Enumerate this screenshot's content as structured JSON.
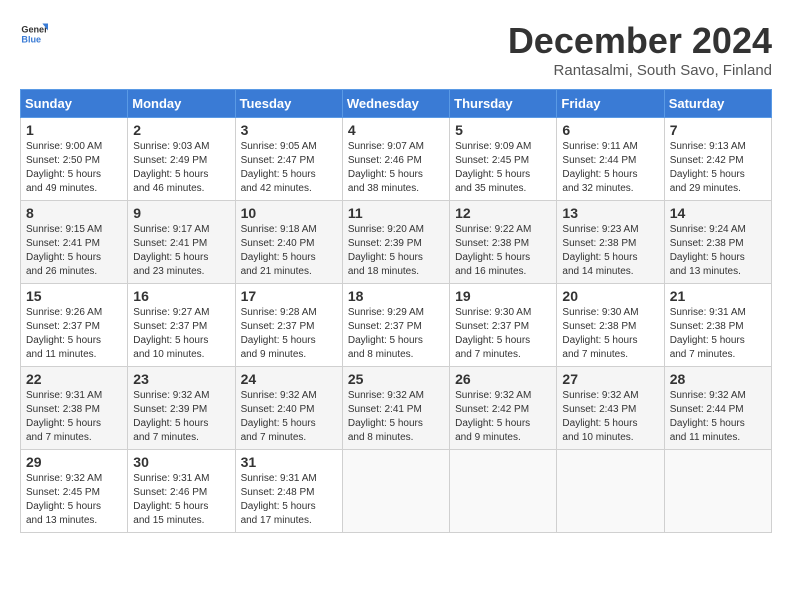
{
  "logo": {
    "general": "General",
    "blue": "Blue"
  },
  "title": "December 2024",
  "location": "Rantasalmi, South Savo, Finland",
  "days_of_week": [
    "Sunday",
    "Monday",
    "Tuesday",
    "Wednesday",
    "Thursday",
    "Friday",
    "Saturday"
  ],
  "weeks": [
    [
      {
        "day": "1",
        "sunrise": "9:00 AM",
        "sunset": "2:50 PM",
        "daylight_hours": "5",
        "daylight_minutes": "49"
      },
      {
        "day": "2",
        "sunrise": "9:03 AM",
        "sunset": "2:49 PM",
        "daylight_hours": "5",
        "daylight_minutes": "46"
      },
      {
        "day": "3",
        "sunrise": "9:05 AM",
        "sunset": "2:47 PM",
        "daylight_hours": "5",
        "daylight_minutes": "42"
      },
      {
        "day": "4",
        "sunrise": "9:07 AM",
        "sunset": "2:46 PM",
        "daylight_hours": "5",
        "daylight_minutes": "38"
      },
      {
        "day": "5",
        "sunrise": "9:09 AM",
        "sunset": "2:45 PM",
        "daylight_hours": "5",
        "daylight_minutes": "35"
      },
      {
        "day": "6",
        "sunrise": "9:11 AM",
        "sunset": "2:44 PM",
        "daylight_hours": "5",
        "daylight_minutes": "32"
      },
      {
        "day": "7",
        "sunrise": "9:13 AM",
        "sunset": "2:42 PM",
        "daylight_hours": "5",
        "daylight_minutes": "29"
      }
    ],
    [
      {
        "day": "8",
        "sunrise": "9:15 AM",
        "sunset": "2:41 PM",
        "daylight_hours": "5",
        "daylight_minutes": "26"
      },
      {
        "day": "9",
        "sunrise": "9:17 AM",
        "sunset": "2:41 PM",
        "daylight_hours": "5",
        "daylight_minutes": "23"
      },
      {
        "day": "10",
        "sunrise": "9:18 AM",
        "sunset": "2:40 PM",
        "daylight_hours": "5",
        "daylight_minutes": "21"
      },
      {
        "day": "11",
        "sunrise": "9:20 AM",
        "sunset": "2:39 PM",
        "daylight_hours": "5",
        "daylight_minutes": "18"
      },
      {
        "day": "12",
        "sunrise": "9:22 AM",
        "sunset": "2:38 PM",
        "daylight_hours": "5",
        "daylight_minutes": "16"
      },
      {
        "day": "13",
        "sunrise": "9:23 AM",
        "sunset": "2:38 PM",
        "daylight_hours": "5",
        "daylight_minutes": "14"
      },
      {
        "day": "14",
        "sunrise": "9:24 AM",
        "sunset": "2:38 PM",
        "daylight_hours": "5",
        "daylight_minutes": "13"
      }
    ],
    [
      {
        "day": "15",
        "sunrise": "9:26 AM",
        "sunset": "2:37 PM",
        "daylight_hours": "5",
        "daylight_minutes": "11"
      },
      {
        "day": "16",
        "sunrise": "9:27 AM",
        "sunset": "2:37 PM",
        "daylight_hours": "5",
        "daylight_minutes": "10"
      },
      {
        "day": "17",
        "sunrise": "9:28 AM",
        "sunset": "2:37 PM",
        "daylight_hours": "5",
        "daylight_minutes": "9"
      },
      {
        "day": "18",
        "sunrise": "9:29 AM",
        "sunset": "2:37 PM",
        "daylight_hours": "5",
        "daylight_minutes": "8"
      },
      {
        "day": "19",
        "sunrise": "9:30 AM",
        "sunset": "2:37 PM",
        "daylight_hours": "5",
        "daylight_minutes": "7"
      },
      {
        "day": "20",
        "sunrise": "9:30 AM",
        "sunset": "2:38 PM",
        "daylight_hours": "5",
        "daylight_minutes": "7"
      },
      {
        "day": "21",
        "sunrise": "9:31 AM",
        "sunset": "2:38 PM",
        "daylight_hours": "5",
        "daylight_minutes": "7"
      }
    ],
    [
      {
        "day": "22",
        "sunrise": "9:31 AM",
        "sunset": "2:38 PM",
        "daylight_hours": "5",
        "daylight_minutes": "7"
      },
      {
        "day": "23",
        "sunrise": "9:32 AM",
        "sunset": "2:39 PM",
        "daylight_hours": "5",
        "daylight_minutes": "7"
      },
      {
        "day": "24",
        "sunrise": "9:32 AM",
        "sunset": "2:40 PM",
        "daylight_hours": "5",
        "daylight_minutes": "7"
      },
      {
        "day": "25",
        "sunrise": "9:32 AM",
        "sunset": "2:41 PM",
        "daylight_hours": "5",
        "daylight_minutes": "8"
      },
      {
        "day": "26",
        "sunrise": "9:32 AM",
        "sunset": "2:42 PM",
        "daylight_hours": "5",
        "daylight_minutes": "9"
      },
      {
        "day": "27",
        "sunrise": "9:32 AM",
        "sunset": "2:43 PM",
        "daylight_hours": "5",
        "daylight_minutes": "10"
      },
      {
        "day": "28",
        "sunrise": "9:32 AM",
        "sunset": "2:44 PM",
        "daylight_hours": "5",
        "daylight_minutes": "11"
      }
    ],
    [
      {
        "day": "29",
        "sunrise": "9:32 AM",
        "sunset": "2:45 PM",
        "daylight_hours": "5",
        "daylight_minutes": "13"
      },
      {
        "day": "30",
        "sunrise": "9:31 AM",
        "sunset": "2:46 PM",
        "daylight_hours": "5",
        "daylight_minutes": "15"
      },
      {
        "day": "31",
        "sunrise": "9:31 AM",
        "sunset": "2:48 PM",
        "daylight_hours": "5",
        "daylight_minutes": "17"
      },
      null,
      null,
      null,
      null
    ]
  ]
}
